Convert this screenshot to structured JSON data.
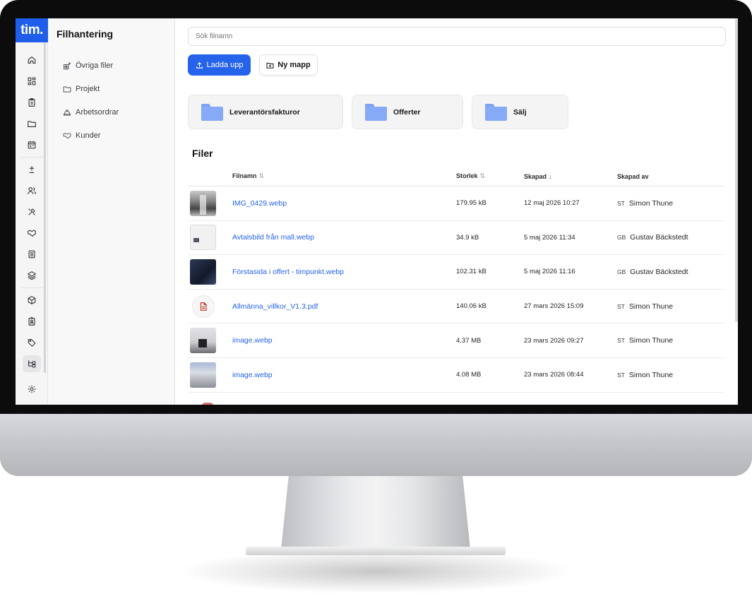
{
  "app": {
    "logo": "tim.",
    "section_title": "Filhantering"
  },
  "rail": {
    "icons": [
      "home-icon",
      "dashboard-grid-icon",
      "clipboard-icon",
      "folder-icon",
      "calendar-icon",
      "plus-minus-icon",
      "users-icon",
      "tools-icon",
      "handshake-icon",
      "document-list-icon",
      "layers-icon",
      "package-icon",
      "id-badge-icon",
      "tag-icon",
      "file-tree-icon"
    ],
    "active_icon": "file-tree-icon",
    "bottom_icon": "settings-icon"
  },
  "sidebar": {
    "items": [
      {
        "label": "Övriga filer",
        "icon": "grid-plus-icon"
      },
      {
        "label": "Projekt",
        "icon": "folder-icon"
      },
      {
        "label": "Arbetsordrar",
        "icon": "hard-hat-icon"
      },
      {
        "label": "Kunder",
        "icon": "handshake-icon"
      }
    ]
  },
  "search": {
    "placeholder": "Sök filnamn"
  },
  "toolbar": {
    "upload_label": "Ladda upp",
    "new_folder_label": "Ny mapp"
  },
  "folders": [
    {
      "name": "Leverantörsfakturor"
    },
    {
      "name": "Offerter"
    },
    {
      "name": "Sälj"
    }
  ],
  "files": {
    "heading": "Filer",
    "columns": {
      "name": "Filnamn",
      "size": "Storlek",
      "created": "Skapad",
      "created_by": "Skapad av"
    },
    "sort": {
      "column": "Skapad",
      "direction": "desc"
    },
    "rows": [
      {
        "thumb": "image",
        "name": "IMG_0429.webp",
        "size": "179.95 kB",
        "created": "12 maj 2026 10:27",
        "initials": "ST",
        "by": "Simon Thune"
      },
      {
        "thumb": "image",
        "name": "Avtalsbild från mall.webp",
        "size": "34.9 kB",
        "created": "5 maj 2026 11:34",
        "initials": "GB",
        "by": "Gustav Bäckstedt"
      },
      {
        "thumb": "image",
        "name": "Förstasida i offert - timpunkt.webp",
        "size": "102.31 kB",
        "created": "5 maj 2026 11:16",
        "initials": "GB",
        "by": "Gustav Bäckstedt"
      },
      {
        "thumb": "pdf",
        "name": "Allmänna_villkor_V1.3.pdf",
        "size": "140.06 kB",
        "created": "27 mars 2026 15:09",
        "initials": "ST",
        "by": "Simon Thune"
      },
      {
        "thumb": "image",
        "name": "image.webp",
        "size": "4.37 MB",
        "created": "23 mars 2026 09:27",
        "initials": "ST",
        "by": "Simon Thune"
      },
      {
        "thumb": "image",
        "name": "image.webp",
        "size": "4.08 MB",
        "created": "23 mars 2026 08:44",
        "initials": "ST",
        "by": "Simon Thune"
      }
    ]
  },
  "colors": {
    "accent": "#2563eb",
    "logo_bg": "#1f5eea",
    "folder": "#86aaf5",
    "pdf": "#c0392b"
  }
}
